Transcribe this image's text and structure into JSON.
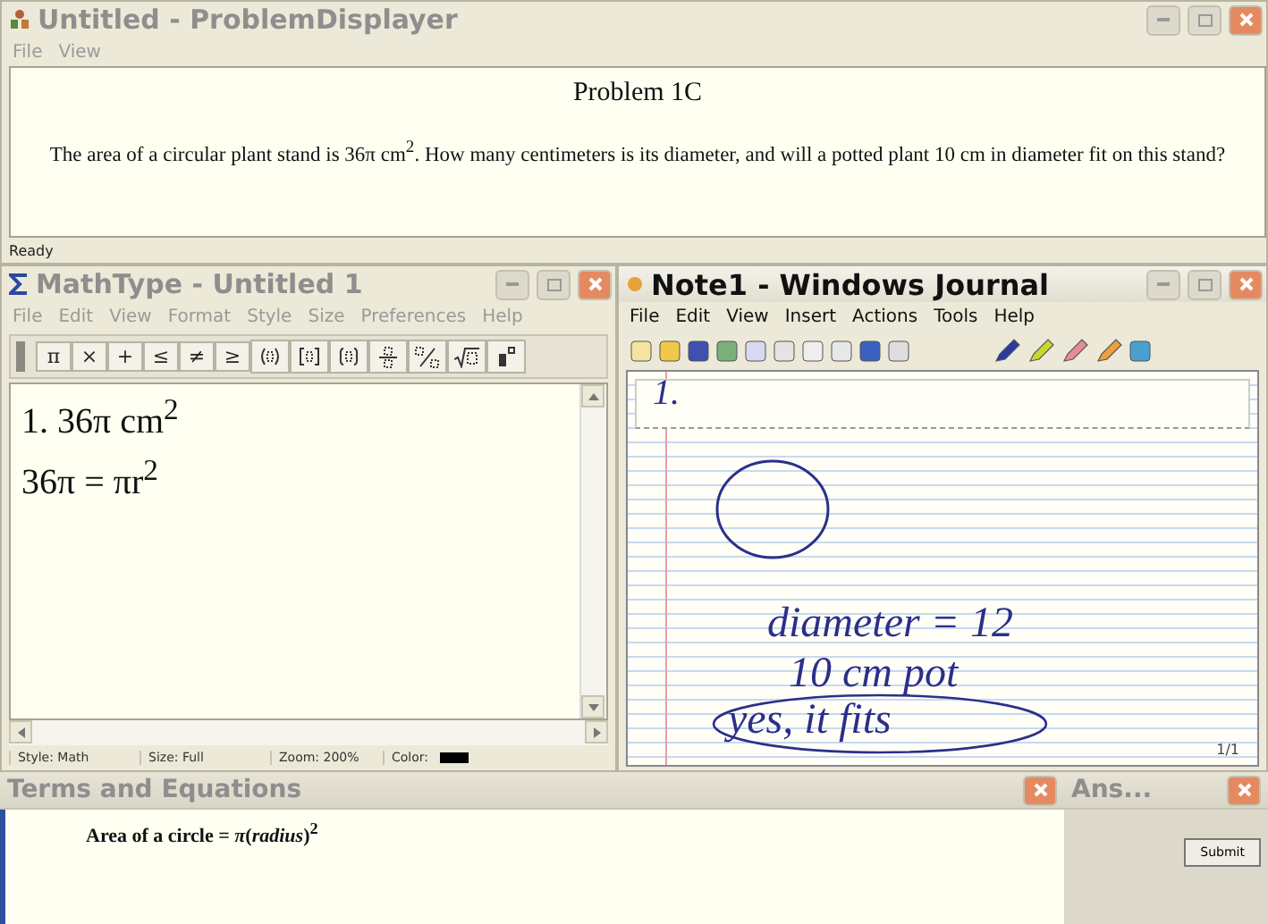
{
  "problem_window": {
    "title": "Untitled - ProblemDisplayer",
    "menu": [
      "File",
      "View"
    ],
    "heading": "Problem 1C",
    "question": "The area of a circular plant stand is 36π cm$^{2}$. How many centimeters is its diameter, and will a potted plant 10 cm in diameter fit on this stand?",
    "status": "Ready"
  },
  "mathtype": {
    "title": "MathType - Untitled 1",
    "menu": [
      "File",
      "Edit",
      "View",
      "Format",
      "Style",
      "Size",
      "Preferences",
      "Help"
    ],
    "symbols": [
      {
        "kind": "glyph",
        "text": "π"
      },
      {
        "kind": "glyph",
        "text": "×"
      },
      {
        "kind": "glyph",
        "text": "+"
      },
      {
        "kind": "glyph",
        "text": "≤"
      },
      {
        "kind": "glyph",
        "text": "≠"
      },
      {
        "kind": "glyph",
        "text": "≥"
      },
      {
        "kind": "parens"
      },
      {
        "kind": "brackets"
      },
      {
        "kind": "braces"
      },
      {
        "kind": "fraction"
      },
      {
        "kind": "slash-fraction"
      },
      {
        "kind": "root"
      },
      {
        "kind": "superscript"
      }
    ],
    "lines": [
      "1. 36π cm$^{2}$",
      "36π = πr$^{2}$"
    ],
    "status": [
      {
        "text": "Style: Math"
      },
      {
        "text": "Size: Full"
      },
      {
        "text": "Zoom: 200%"
      },
      {
        "text": "Color:",
        "color": "#000000"
      }
    ]
  },
  "journal": {
    "title": "Note1 - Windows Journal",
    "menu": [
      "File",
      "Edit",
      "View",
      "Insert",
      "Actions",
      "Tools",
      "Help"
    ],
    "page_title": "1.",
    "ink": [
      "diameter = 12",
      "10 cm pot",
      "yes, it fits"
    ],
    "page_counter": "1/1"
  },
  "terms_panel": {
    "title": "Terms and Equations",
    "equation": "Area of a circle = *π*(*radius*)$^{2}$"
  },
  "answer_panel": {
    "title": "Ans...",
    "submit": "Submit"
  }
}
